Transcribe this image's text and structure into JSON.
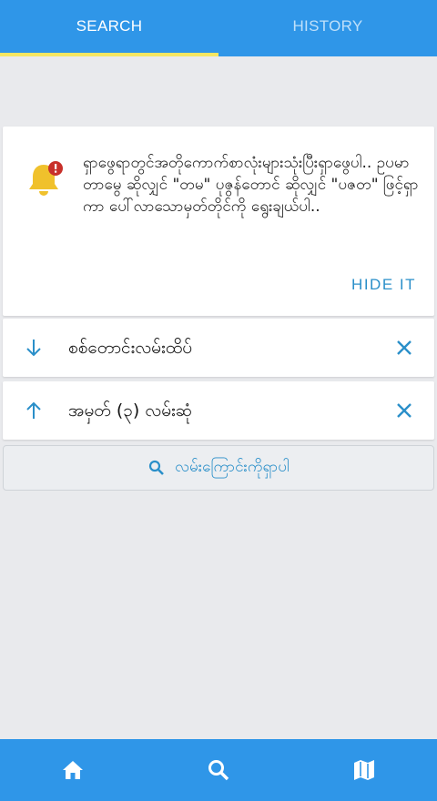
{
  "tabs": {
    "search_label": "SEARCH",
    "history_label": "HISTORY"
  },
  "notice": {
    "icon": "bell-alert-icon",
    "message": "ရှာဖွေရာတွင်အတိုကောက်စာလုံးများသုံးပြီးရှာဖွေပါ.. ဥပမာ တာမွေ ဆိုလျှင် \"တမ\" ပုဇွန်တောင် ဆိုလျှင် \"ပဇတ\" ဖြင့်ရှာကာ ပေါ်လာသောမှတ်တိုင်ကို ရွေးချယ်ပါ..",
    "hide_label": "HIDE IT"
  },
  "route": {
    "from_label": "စစ်တောင်းလမ်းထိပ်",
    "to_label": "အမှတ် (၃) လမ်းဆုံ"
  },
  "search_button_label": "လမ်းကြောင်းကိုရှာပါ",
  "bottom_nav": [
    "home-icon",
    "search-icon",
    "map-icon"
  ],
  "colors": {
    "primary": "#2f96e8",
    "accent_text": "#2a8fc9",
    "tab_indicator": "#f5e662",
    "bell": "#f0c12c",
    "alert_badge": "#c8302a"
  }
}
